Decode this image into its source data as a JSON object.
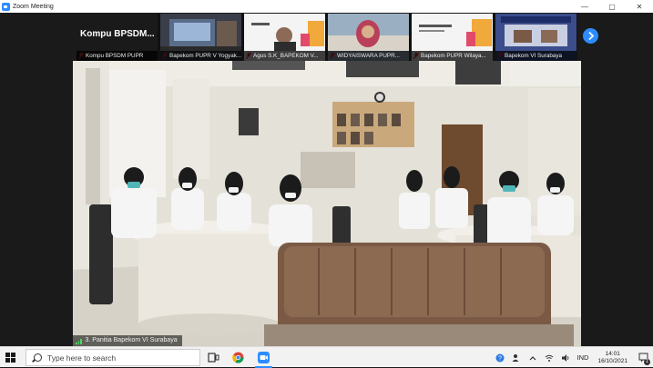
{
  "window": {
    "title": "Zoom Meeting",
    "controls": [
      "—",
      "▢",
      "✕"
    ]
  },
  "meeting": {
    "self_tile_label": "Kompu  BPSDM...",
    "tiles": [
      {
        "name": "Kompu  BPSDM PUPR"
      },
      {
        "name": "Bapekom PUPR V Yogyak..."
      },
      {
        "name": "Agus S.K_BAPEKOM V..."
      },
      {
        "name": "WIDYAISWARA PUPR..."
      },
      {
        "name": "Bapekom PUPR Wilaya..."
      },
      {
        "name": "Bapekom VI Surabaya"
      }
    ],
    "next_icon": "chevron-right-icon",
    "active_speaker": "3. Panitia Bapekom VI Surabaya"
  },
  "taskbar": {
    "search_placeholder": "Type here to search",
    "language": "IND",
    "time": "14:01",
    "date": "16/10/2021",
    "notification_count": "1"
  }
}
